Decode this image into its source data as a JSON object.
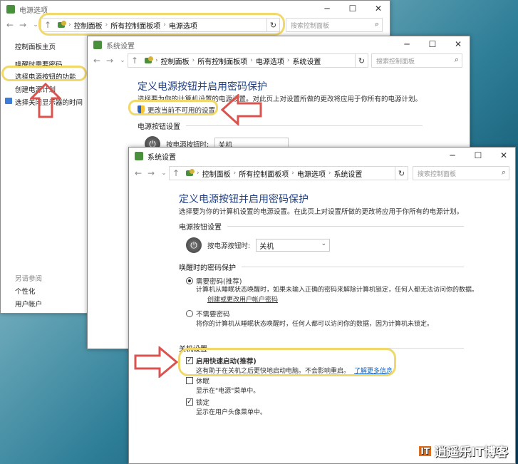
{
  "colors": {
    "highlight": "#f1d86a",
    "arrow": "#d9534f",
    "link": "#1565c0",
    "title": "#1e3f8a"
  },
  "win1": {
    "title": "电源选项",
    "breadcrumb": [
      "控制面板",
      "所有控制面板项",
      "电源选项"
    ],
    "search_placeholder": "搜索控制面板",
    "sidebar": {
      "home": "控制面板主页",
      "items": [
        "唤醒时需要密码",
        "选择电源按钮的功能",
        "创建电源计划",
        "选择关闭显示器的时间"
      ],
      "see_also_title": "另请参阅",
      "see_also": [
        "个性化",
        "用户帐户"
      ]
    }
  },
  "win2": {
    "title": "系统设置",
    "breadcrumb": [
      "控制面板",
      "所有控制面板项",
      "电源选项",
      "系统设置"
    ],
    "search_placeholder": "搜索控制面板",
    "heading": "定义电源按钮并启用密码保护",
    "desc": "选择要为你的计算机设置的电源设置。对此页上对设置所做的更改将应用于你所有的电源计划。",
    "change_link": "更改当前不可用的设置",
    "section_power": "电源按钮设置",
    "power_label": "按电源按钮时:",
    "power_value": "关机"
  },
  "win3": {
    "title": "系统设置",
    "breadcrumb": [
      "控制面板",
      "所有控制面板项",
      "电源选项",
      "系统设置"
    ],
    "search_placeholder": "搜索控制面板",
    "heading": "定义电源按钮并启用密码保护",
    "desc": "选择要为你的计算机设置的电源设置。在此页上对设置所做的更改将应用于你所有的电源计划。",
    "section_power": "电源按钮设置",
    "power_label": "按电源按钮时:",
    "power_value": "关机",
    "section_wake": "唤醒时的密码保护",
    "opt_require": "需要密码(推荐)",
    "opt_require_desc": "计算机从睡眠状态唤醒时，如果未输入正确的密码来解除计算机锁定，任何人都无法访问你的数据。",
    "opt_require_link": "创建或更改用户帐户密码",
    "opt_norequire": "不需要密码",
    "opt_norequire_desc": "将你的计算机从睡眠状态唤醒时，任何人都可以访问你的数据，因为计算机未锁定。",
    "section_shutdown": "关机设置",
    "fast_startup": "启用快速启动(推荐)",
    "fast_startup_desc": "这有助于在关机之后更快地启动电脑。不会影响重启。",
    "learn_more": "了解更多信息",
    "hibernate": "休眠",
    "hibernate_desc": "显示在\"电源\"菜单中。",
    "lock": "锁定",
    "lock_desc": "显示在用户头像菜单中。"
  },
  "watermark": {
    "badge": "IT",
    "text": "逍遥乐IT博客"
  }
}
